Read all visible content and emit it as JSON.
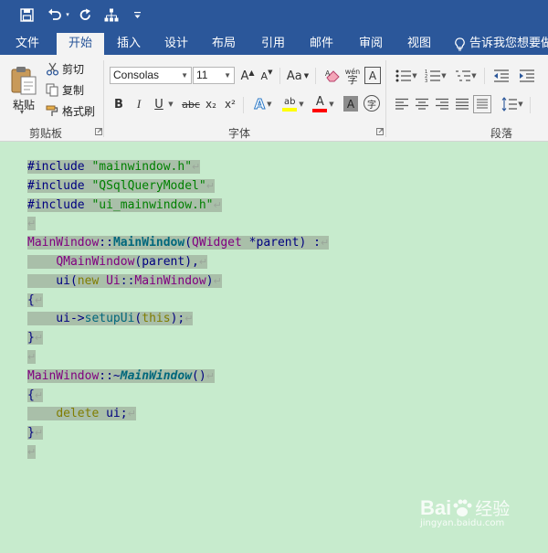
{
  "qat": {
    "save_icon": "save-icon",
    "undo_icon": "undo-icon",
    "redo_icon": "redo-icon",
    "tree_icon": "structure-icon",
    "customize_icon": "customize-icon"
  },
  "tabs": [
    {
      "label": "文件"
    },
    {
      "label": "开始",
      "active": true
    },
    {
      "label": "插入"
    },
    {
      "label": "设计"
    },
    {
      "label": "布局"
    },
    {
      "label": "引用"
    },
    {
      "label": "邮件"
    },
    {
      "label": "审阅"
    },
    {
      "label": "视图"
    }
  ],
  "tellme": "告诉我您想要做",
  "clipboard": {
    "paste": "粘贴",
    "cut": "剪切",
    "copy": "复制",
    "format_painter": "格式刷",
    "group_label": "剪贴板"
  },
  "font": {
    "name": "Consolas",
    "size": "11",
    "grow": "A",
    "shrink": "A",
    "case": "Aa",
    "bold": "B",
    "italic": "I",
    "underline": "U",
    "strike": "abc",
    "subscript": "x₂",
    "superscript": "x²",
    "effects": "A",
    "highlight": "ab",
    "font_color": "A",
    "char_shading": "A",
    "enclose": "字",
    "pinyin": "wén",
    "border_char": "A",
    "group_label": "字体"
  },
  "paragraph": {
    "group_label": "段落"
  },
  "colors": {
    "word_blue": "#2b579a",
    "doc_bg": "#c7ebcd",
    "selection": "#a9bfa9",
    "highlight_yellow": "#ffff00",
    "font_red": "#ff0000"
  },
  "code": {
    "l1": {
      "a": "#include ",
      "b": "\"mainwindow.h\""
    },
    "l2": {
      "a": "#include ",
      "b": "\"QSqlQueryModel\""
    },
    "l3": {
      "a": "#include ",
      "b": "\"ui_mainwindow.h\""
    },
    "l5": {
      "a": "MainWindow",
      "b": "::",
      "c": "MainWindow",
      "d": "(",
      "e": "QWidget",
      "f": " *parent) :"
    },
    "l6": {
      "a": "    ",
      "b": "QMainWindow",
      "c": "(parent),"
    },
    "l7": {
      "a": "    ui(",
      "b": "new",
      "c": " ",
      "d": "Ui",
      "e": "::",
      "f": "MainWindow",
      "g": ")"
    },
    "l8": {
      "a": "{"
    },
    "l9": {
      "a": "    ui->",
      "b": "setupUi",
      "c": "(",
      "d": "this",
      "e": ");"
    },
    "l10": {
      "a": "}"
    },
    "l12": {
      "a": "MainWindow",
      "b": "::~",
      "c": "MainWindow",
      "d": "()"
    },
    "l13": {
      "a": "{"
    },
    "l14": {
      "a": "    ",
      "b": "delete",
      "c": " ui;"
    },
    "l15": {
      "a": "}"
    },
    "pilcrow": "↵"
  },
  "watermark": {
    "logo": "Bai",
    "brand": "经验",
    "url": "jingyan.baidu.com"
  }
}
